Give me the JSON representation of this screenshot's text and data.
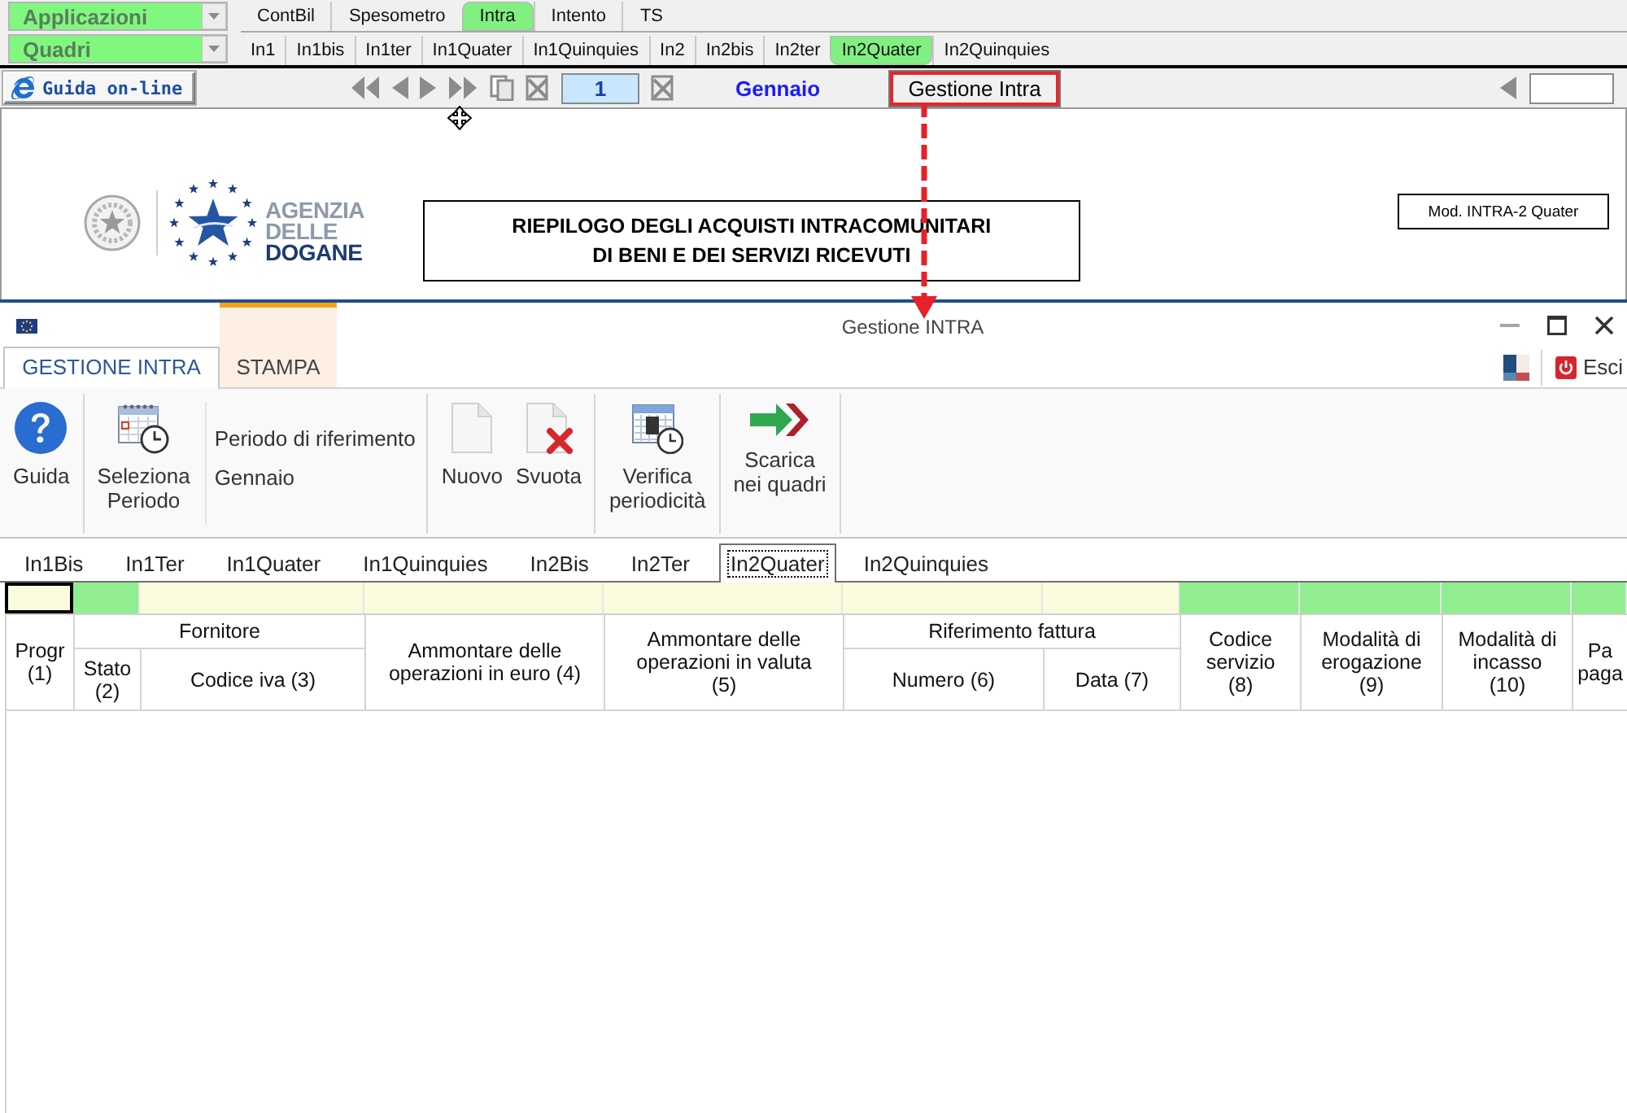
{
  "app_bar": {
    "applications_dropdown": "Applicazioni",
    "app_tabs": [
      {
        "label": "ContBil",
        "selected": false
      },
      {
        "label": "Spesometro",
        "selected": false
      },
      {
        "label": "Intra",
        "selected": true
      },
      {
        "label": "Intento",
        "selected": false
      },
      {
        "label": "TS",
        "selected": false
      }
    ],
    "sections_dropdown": "Quadri",
    "section_tabs": [
      {
        "label": "In1",
        "selected": false
      },
      {
        "label": "In1bis",
        "selected": false
      },
      {
        "label": "In1ter",
        "selected": false
      },
      {
        "label": "In1Quater",
        "selected": false
      },
      {
        "label": "In1Quinquies",
        "selected": false
      },
      {
        "label": "In2",
        "selected": false
      },
      {
        "label": "In2bis",
        "selected": false
      },
      {
        "label": "In2ter",
        "selected": false
      },
      {
        "label": "In2Quater",
        "selected": true
      },
      {
        "label": "In2Quinquies",
        "selected": false
      }
    ]
  },
  "toolbar": {
    "help_button": "Guida on-line",
    "page_number": "1",
    "month": "Gennaio",
    "manage_button": {
      "label": "Gestione Intra",
      "highlighted": true
    }
  },
  "document": {
    "wordmark_lines": [
      "AGENZIA",
      "DELLE",
      "DOGANE"
    ],
    "title_lines": [
      "RIEPILOGO DEGLI ACQUISTI INTRACOMUNITARI",
      "DI BENI E DEI SERVIZI RICEVUTI"
    ],
    "model": "Mod. INTRA-2 Quater"
  },
  "window": {
    "title": "Gestione INTRA",
    "ribbon_tabs": [
      {
        "label": "GESTIONE INTRA",
        "selected": true,
        "contextual": false
      },
      {
        "label": "STAMPA",
        "selected": false,
        "contextual": true
      }
    ],
    "exit_button": "Esci"
  },
  "ribbon": {
    "groups": [
      {
        "items": [
          {
            "kind": "button",
            "label": "Guida"
          }
        ]
      },
      {
        "items": [
          {
            "kind": "button",
            "label": "Seleziona\nPeriodo"
          },
          {
            "kind": "info",
            "label": "Periodo di riferimento",
            "value": "Gennaio"
          }
        ]
      },
      {
        "items": [
          {
            "kind": "button",
            "label": "Nuovo"
          },
          {
            "kind": "button",
            "label": "Svuota"
          }
        ]
      },
      {
        "items": [
          {
            "kind": "button",
            "label": "Verifica\nperiodicità"
          }
        ]
      },
      {
        "items": [
          {
            "kind": "button",
            "label": "Scarica\nnei quadri"
          }
        ]
      }
    ]
  },
  "sheet_tabs": [
    {
      "label": "In1Bis",
      "selected": false
    },
    {
      "label": "In1Ter",
      "selected": false
    },
    {
      "label": "In1Quater",
      "selected": false
    },
    {
      "label": "In1Quinquies",
      "selected": false
    },
    {
      "label": "In2Bis",
      "selected": false
    },
    {
      "label": "In2Ter",
      "selected": false
    },
    {
      "label": "In2Quater",
      "selected": true
    },
    {
      "label": "In2Quinquies",
      "selected": false
    }
  ],
  "table": {
    "filter_cells": [
      {
        "color": "#fafadc",
        "selected": true
      },
      {
        "color": "#90ee90",
        "selected": false
      },
      {
        "color": "#fafadc",
        "selected": false
      },
      {
        "color": "#fafadc",
        "selected": false
      },
      {
        "color": "#fafadc",
        "selected": false
      },
      {
        "color": "#fafadc",
        "selected": false
      },
      {
        "color": "#fafadc",
        "selected": false
      },
      {
        "color": "#90ee90",
        "selected": false
      },
      {
        "color": "#90ee90",
        "selected": false
      },
      {
        "color": "#90ee90",
        "selected": false
      },
      {
        "color": "#90ee90",
        "selected": false
      }
    ],
    "columns": [
      {
        "label": "Progr\n(1)"
      },
      {
        "label": "Fornitore",
        "children": [
          {
            "label": "Stato\n(2)"
          },
          {
            "label": "Codice iva (3)"
          }
        ]
      },
      {
        "label": "Ammontare delle\noperazioni in euro (4)"
      },
      {
        "label": "Ammontare delle\noperazioni in valuta\n(5)"
      },
      {
        "label": "Riferimento fattura",
        "children": [
          {
            "label": "Numero (6)"
          },
          {
            "label": "Data (7)"
          }
        ]
      },
      {
        "label": "Codice\nservizio\n(8)"
      },
      {
        "label": "Modalità di\nerogazione\n(9)"
      },
      {
        "label": "Modalità di\nincasso\n(10)"
      },
      {
        "label": "Pa\npaga"
      }
    ]
  }
}
